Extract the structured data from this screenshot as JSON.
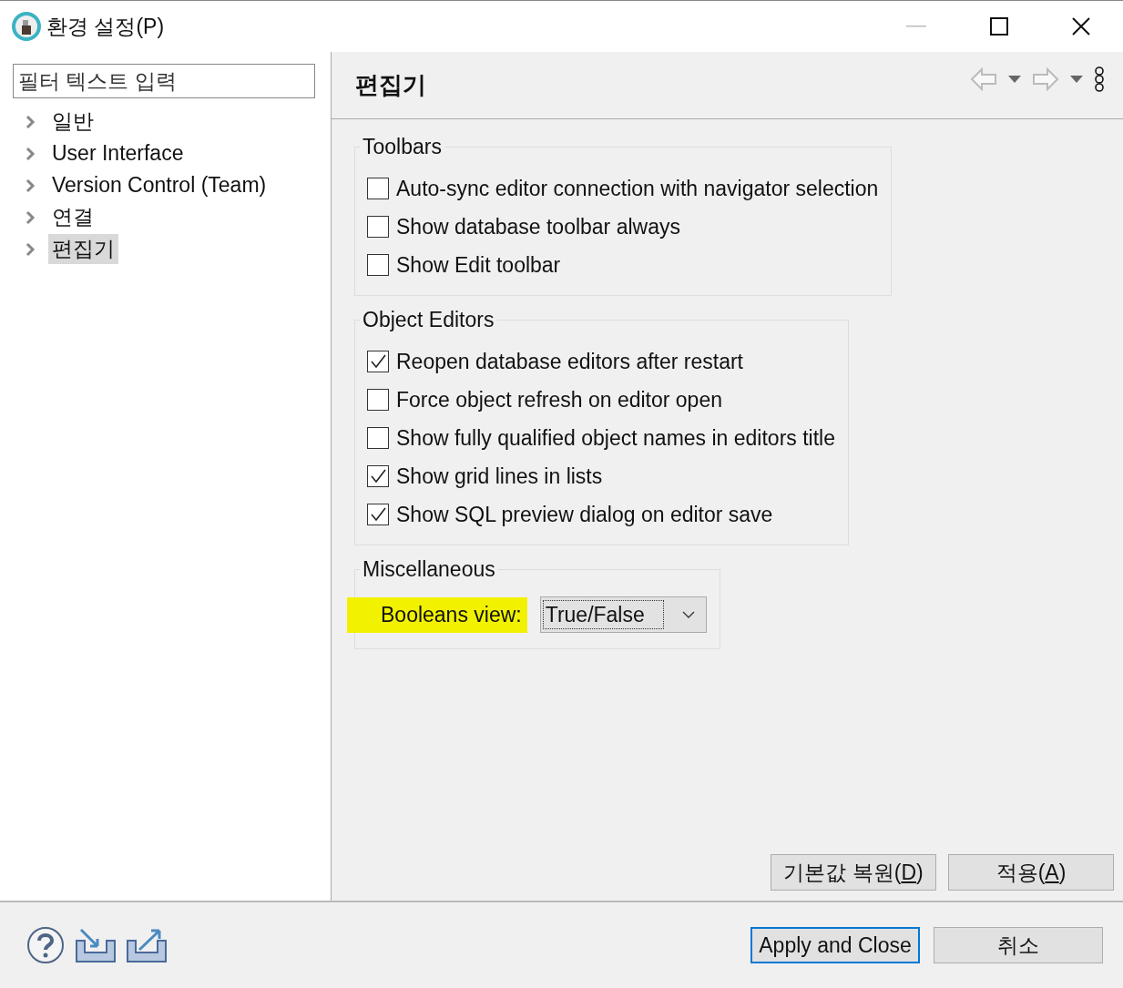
{
  "window": {
    "title": "환경 설정(P)"
  },
  "sidebar": {
    "filter": {
      "placeholder": "필터 텍스트 입력"
    },
    "items": [
      {
        "label": "일반",
        "selected": false,
        "expanded": false
      },
      {
        "label": "User Interface",
        "selected": false,
        "expanded": false
      },
      {
        "label": "Version Control (Team)",
        "selected": false,
        "expanded": false
      },
      {
        "label": "연결",
        "selected": false,
        "expanded": false
      },
      {
        "label": "편집기",
        "selected": true,
        "expanded": false
      }
    ]
  },
  "page": {
    "title": "편집기",
    "groups": [
      {
        "title": "Toolbars",
        "items": [
          {
            "kind": "checkbox",
            "label": "Auto-sync editor connection with navigator selection",
            "checked": false
          },
          {
            "kind": "checkbox",
            "label": "Show database toolbar always",
            "checked": false
          },
          {
            "kind": "checkbox",
            "label": "Show Edit toolbar",
            "checked": false
          }
        ]
      },
      {
        "title": "Object Editors",
        "items": [
          {
            "kind": "checkbox",
            "label": "Reopen database editors after restart",
            "checked": true
          },
          {
            "kind": "checkbox",
            "label": "Force object refresh on editor open",
            "checked": false
          },
          {
            "kind": "checkbox",
            "label": "Show fully qualified object names in editors title",
            "checked": false
          },
          {
            "kind": "checkbox",
            "label": "Show grid lines in lists",
            "checked": true
          },
          {
            "kind": "checkbox",
            "label": "Show SQL preview dialog on editor save",
            "checked": true
          }
        ]
      },
      {
        "title": "Miscellaneous",
        "items": [
          {
            "kind": "dropdown",
            "label": "Booleans view:",
            "value": "True/False",
            "highlighted": true
          }
        ]
      }
    ],
    "buttons": [
      {
        "before": "기본값 복원(",
        "mnemonic": "D",
        "after": ")"
      },
      {
        "before": "적용(",
        "mnemonic": "A",
        "after": ")"
      }
    ]
  },
  "footer": {
    "buttons": [
      {
        "label": "Apply and Close",
        "default": true
      },
      {
        "label": "취소",
        "default": false
      }
    ]
  }
}
